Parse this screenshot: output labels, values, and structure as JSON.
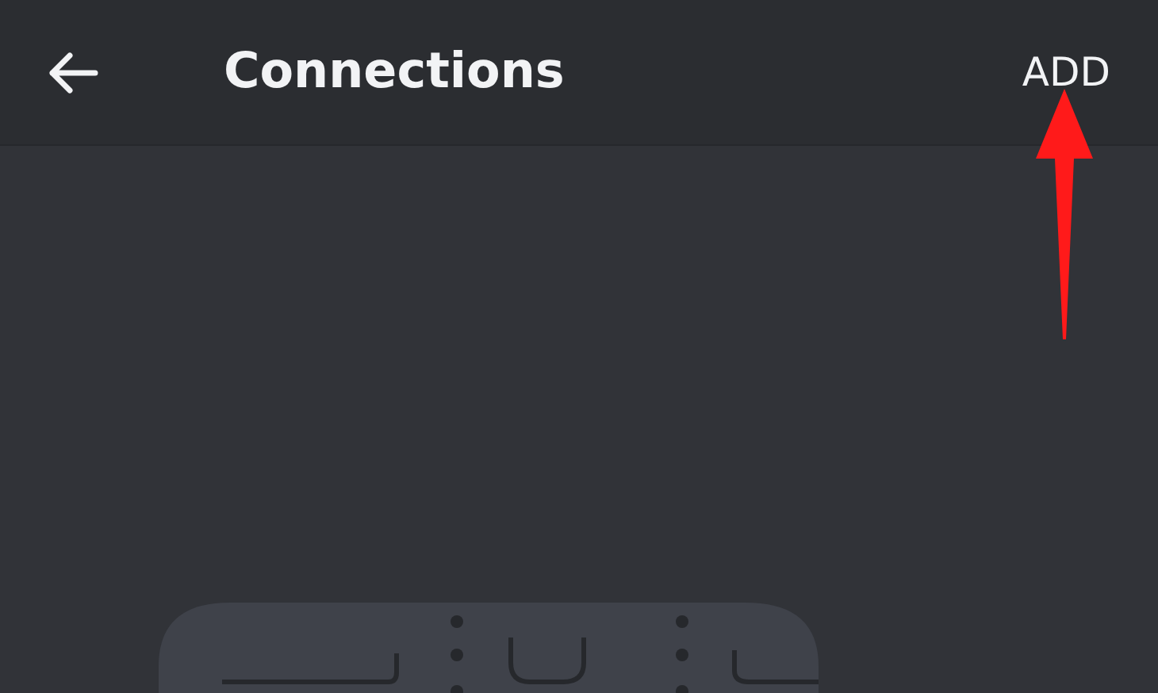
{
  "header": {
    "title": "Connections",
    "action": "ADD"
  }
}
